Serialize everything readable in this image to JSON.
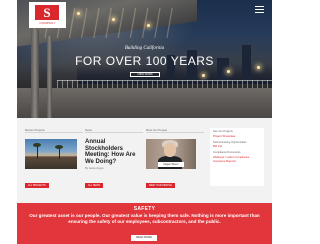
{
  "brand": {
    "logo_text": "COMPANY",
    "accent": "#d8272d"
  },
  "hero": {
    "subtitle": "Building California",
    "title": "FOR OVER 100 YEARS",
    "button": "VIEW WORK"
  },
  "cards": {
    "recent_projects": {
      "heading": "Recent Projects",
      "button": "ALL PROJECTS"
    },
    "news": {
      "heading": "News",
      "title": "Annual Stockholders Meeting: How Are We Doing?",
      "byline": "By Jamie Angus",
      "button": "ALL NEWS"
    },
    "meet_our_people": {
      "heading": "Meet Our People",
      "caption": "Megan Zherer",
      "button": "MEET OUR PEOPLE"
    },
    "sidebar": {
      "new_projects_label": "See Our Projects",
      "new_projects_link": "Project Showcase",
      "subcontracting_label": "Subcontracting Opportunities",
      "subcontracting_link": "Bid List",
      "compliance_label": "Compliance Documents",
      "compliance_link_1": "Wellness / Labor Compliance",
      "compliance_link_2": "Insurance Reports"
    }
  },
  "safety": {
    "title": "SAFETY",
    "body": "Our greatest asset is our people. Our greatest value is keeping them safe. Nothing is more important than ensuring the safety of our employees, subcontractors, and the public.",
    "button": "READ MORE"
  }
}
